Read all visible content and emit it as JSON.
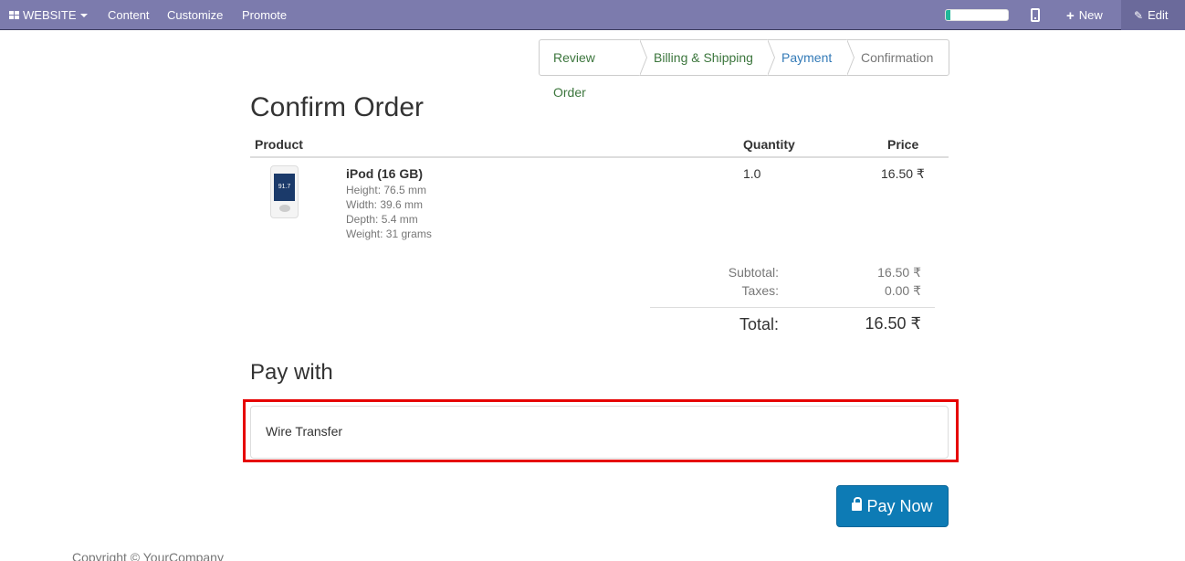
{
  "topbar": {
    "website_label": "WEBSITE",
    "menu": [
      "Content",
      "Customize",
      "Promote"
    ],
    "progress_percent": 8,
    "new_label": "New",
    "edit_label": "Edit"
  },
  "steps": [
    "Review Order",
    "Billing & Shipping",
    "Payment",
    "Confirmation"
  ],
  "page_title": "Confirm Order",
  "table": {
    "headers": {
      "product": "Product",
      "quantity": "Quantity",
      "price": "Price"
    },
    "rows": [
      {
        "thumb_text": "91.7",
        "name": "iPod (16 GB)",
        "attributes": [
          "Height: 76.5 mm",
          "Width: 39.6 mm",
          "Depth: 5.4 mm",
          "Weight: 31 grams"
        ],
        "quantity": "1.0",
        "price": "16.50 ₹"
      }
    ]
  },
  "totals": {
    "subtotal_label": "Subtotal:",
    "subtotal": "16.50 ₹",
    "taxes_label": "Taxes:",
    "taxes": "0.00 ₹",
    "total_label": "Total:",
    "total": "16.50 ₹"
  },
  "pay_with": {
    "heading": "Pay with",
    "option": "Wire Transfer"
  },
  "pay_now_label": "Pay Now",
  "footer": "Copyright © YourCompany",
  "colors": {
    "topbar": "#7c7bad",
    "done_step": "#3c763d",
    "active_step": "#337ab7",
    "pay_button": "#0d7bb5",
    "highlight": "#e60000"
  }
}
